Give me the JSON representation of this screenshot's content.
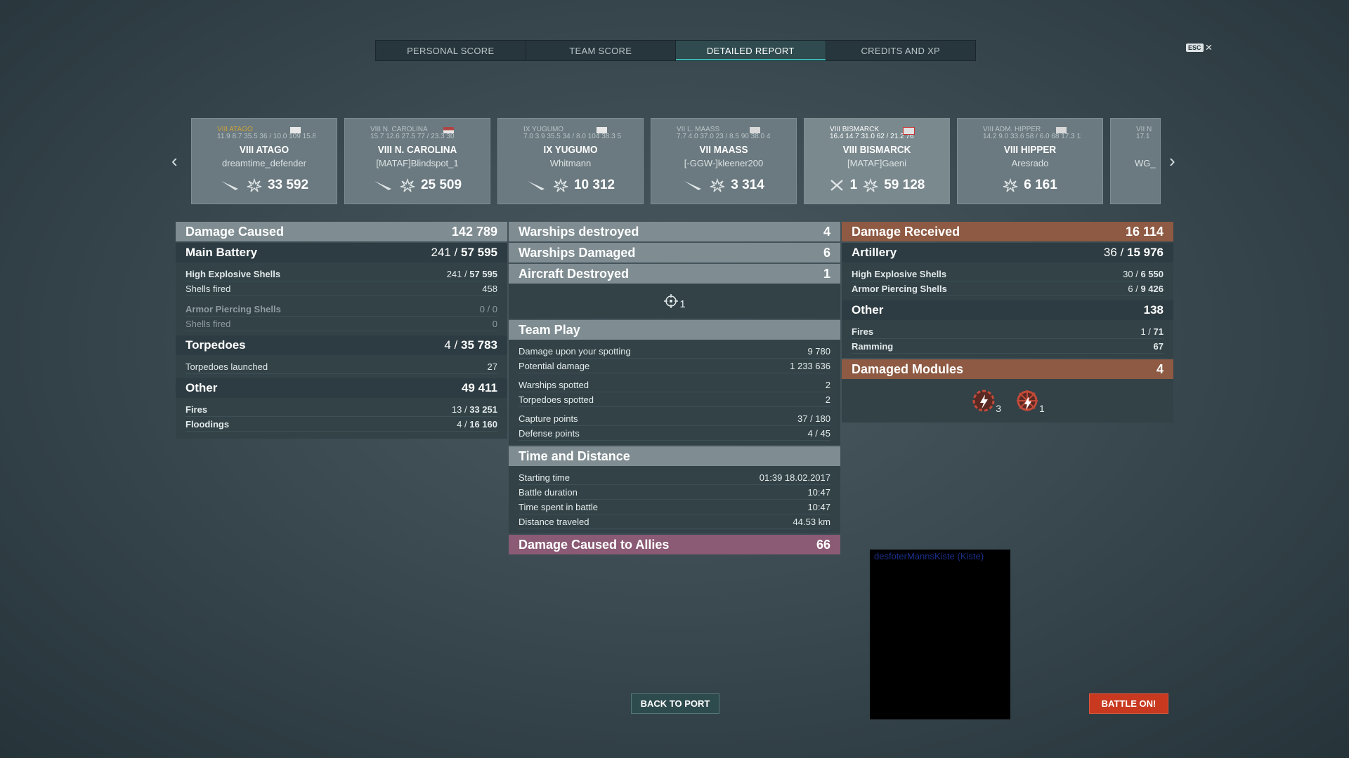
{
  "tabs": [
    {
      "label": "PERSONAL SCORE",
      "active": false
    },
    {
      "label": "TEAM SCORE",
      "active": false
    },
    {
      "label": "DETAILED REPORT",
      "active": true
    },
    {
      "label": "CREDITS AND XP",
      "active": false
    }
  ],
  "esc": {
    "key": "ESC",
    "close": "×"
  },
  "carousel": {
    "prev": "‹",
    "next": "›",
    "cards": [
      {
        "mini_name": "VIII ATAGO",
        "mini_stats": "11.9 8.7 35.5 36 / 10.0 109 15.8 15",
        "ship": "VIII ATAGO",
        "player": "dreamtime_defender",
        "kills": "",
        "damage": "33 592"
      },
      {
        "mini_name": "VIII N. CAROLINA",
        "mini_stats": "15.7 12.6 27.5 77 / 23.3 30",
        "ship": "VIII N. CAROLINA",
        "player": "[MATAF]Blindspot_1",
        "kills": "",
        "damage": "25 509"
      },
      {
        "mini_name": "IX YUGUMO",
        "mini_stats": "7.0 3.9 35.5 34 / 8.0 104 38.3 5",
        "ship": "IX YUGUMO",
        "player": "Whitmann",
        "kills": "",
        "damage": "10 312"
      },
      {
        "mini_name": "VII L. MAASS",
        "mini_stats": "7.7 4.0 37.0 23 / 8.5 90 38.0 4",
        "ship": "VII MAASS",
        "player": "[-GGW-]kleener200",
        "kills": "",
        "damage": "3 314"
      },
      {
        "mini_name": "VIII BISMARCK",
        "mini_stats": "16.4 14.7 31.0 62 / 21.2 76",
        "ship": "VIII BISMARCK",
        "player": "[MATAF]Gaeni",
        "kills": "1",
        "damage": "59 128"
      },
      {
        "mini_name": "VIII ADM. HIPPER",
        "mini_stats": "14.2 9.0 33.6 58 / 6.0 68 17.3 13",
        "ship": "VIII HIPPER",
        "player": "Aresrado",
        "kills": "",
        "damage": "6 161"
      },
      {
        "mini_name": "VII N",
        "mini_stats": "17.1",
        "ship": "",
        "player": "WG_",
        "kills": "",
        "damage": ""
      }
    ]
  },
  "left": {
    "damage_caused": {
      "label": "Damage Caused",
      "value": "142 789"
    },
    "main_battery": {
      "label": "Main Battery",
      "hits": "241",
      "dmg": "57 595"
    },
    "he": {
      "label": "High Explosive Shells",
      "hits": "241",
      "dmg": "57 595",
      "fired_label": "Shells fired",
      "fired": "458"
    },
    "ap": {
      "label": "Armor Piercing Shells",
      "value": "0 / 0",
      "fired_label": "Shells fired",
      "fired": "0"
    },
    "torpedoes": {
      "label": "Torpedoes",
      "hits": "4",
      "dmg": "35 783",
      "launched_label": "Torpedoes launched",
      "launched": "27"
    },
    "other": {
      "label": "Other",
      "value": "49 411"
    },
    "fires": {
      "label": "Fires",
      "hits": "13",
      "dmg": "33 251"
    },
    "floodings": {
      "label": "Floodings",
      "hits": "4",
      "dmg": "16 160"
    }
  },
  "middle": {
    "warships_destroyed": {
      "label": "Warships destroyed",
      "value": "4"
    },
    "warships_damaged": {
      "label": "Warships Damaged",
      "value": "6"
    },
    "aircraft_destroyed": {
      "label": "Aircraft Destroyed",
      "value": "1"
    },
    "aircraft_icon_count": "1",
    "team_play": {
      "label": "Team Play",
      "rows": [
        {
          "label": "Damage upon your spotting",
          "value": "9 780"
        },
        {
          "label": "Potential damage",
          "value": "1 233 636"
        },
        {
          "label": "Warships spotted",
          "value": "2"
        },
        {
          "label": "Torpedoes spotted",
          "value": "2"
        },
        {
          "label": "Capture points",
          "value": "37 / 180"
        },
        {
          "label": "Defense points",
          "value": "4 / 45"
        }
      ]
    },
    "time_distance": {
      "label": "Time and Distance",
      "rows": [
        {
          "label": "Starting time",
          "value": "01:39  18.02.2017"
        },
        {
          "label": "Battle duration",
          "value": "10:47"
        },
        {
          "label": "Time spent in battle",
          "value": "10:47"
        },
        {
          "label": "Distance traveled",
          "value": "44.53 km"
        }
      ]
    },
    "allies": {
      "label": "Damage Caused to Allies",
      "value": "66"
    }
  },
  "right": {
    "damage_received": {
      "label": "Damage Received",
      "value": "16 114"
    },
    "artillery": {
      "label": "Artillery",
      "hits": "36",
      "dmg": "15 976"
    },
    "he": {
      "label": "High Explosive Shells",
      "hits": "30",
      "dmg": "6 550"
    },
    "ap": {
      "label": "Armor Piercing Shells",
      "hits": "6",
      "dmg": "9 426"
    },
    "other": {
      "label": "Other",
      "value": "138"
    },
    "fires": {
      "label": "Fires",
      "hits": "1",
      "dmg": "71"
    },
    "ramming": {
      "label": "Ramming",
      "value": "67"
    },
    "damaged_modules": {
      "label": "Damaged Modules",
      "value": "4",
      "engine_count": "3",
      "steering_count": "1"
    }
  },
  "buttons": {
    "back": "BACK TO PORT",
    "battle": "BATTLE ON!"
  },
  "video": {
    "caption": "desfoterMannsKiste (Kiste)"
  },
  "colors": {
    "accent": "#3fb7b4",
    "orange": "#8e5a43",
    "pink": "#8b5a74",
    "battle": "#c8391f"
  }
}
